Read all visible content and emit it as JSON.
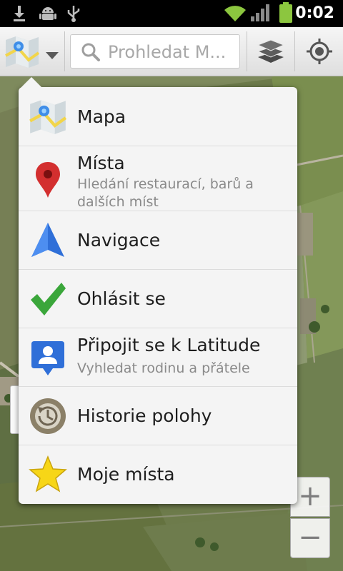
{
  "status_bar": {
    "time": "0:02",
    "icons": [
      "download-icon",
      "android-debug-icon",
      "usb-icon",
      "wifi-icon",
      "signal-icon",
      "battery-icon"
    ]
  },
  "action_bar": {
    "mode_icon": "maps-icon",
    "search_placeholder": "Prohledat M...",
    "layers_icon": "layers-icon",
    "locate_icon": "my-location-icon"
  },
  "menu": {
    "items": [
      {
        "label": "Mapa",
        "icon": "maps-icon"
      },
      {
        "label": "Místa",
        "subtitle": "Hledání restaurací, barů a dalších míst",
        "icon": "places-pin-icon"
      },
      {
        "label": "Navigace",
        "icon": "navigation-arrow-icon"
      },
      {
        "label": "Ohlásit se",
        "icon": "checkmark-icon"
      },
      {
        "label": "Připojit se k Latitude",
        "subtitle": "Vyhledat rodinu a přátele",
        "icon": "latitude-icon"
      },
      {
        "label": "Historie polohy",
        "icon": "location-history-icon"
      },
      {
        "label": "Moje místa",
        "icon": "star-icon"
      }
    ]
  },
  "zoom": {
    "in_label": "+",
    "out_label": "−"
  },
  "colors": {
    "status_bar": "#000000",
    "action_bar": "#e8e8e8",
    "menu_background": "#f4f4f4",
    "battery": "#8cc63f",
    "wifi": "#8cc63f",
    "pin_red": "#d32f2f",
    "nav_blue": "#2f6fd8",
    "check_green": "#3aa63a",
    "star_yellow": "#f7d617"
  }
}
